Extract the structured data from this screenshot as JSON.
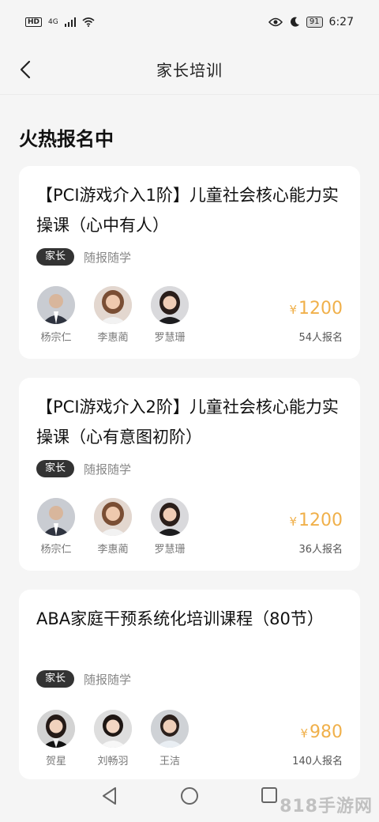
{
  "status_bar": {
    "hd": "HD",
    "network": "4G",
    "battery": "91",
    "time": "6:27"
  },
  "header": {
    "title": "家长培训",
    "back_icon": "chevron-left-icon"
  },
  "section": {
    "title": "火热报名中"
  },
  "courses": [
    {
      "title": "【PCI游戏介入1阶】儿童社会核心能力实操课（心中有人）",
      "tag": "家长",
      "mode": "随报随学",
      "teachers": [
        {
          "name": "杨宗仁"
        },
        {
          "name": "李惠蔺"
        },
        {
          "name": "罗慧珊"
        }
      ],
      "currency": "¥",
      "price": "1200",
      "enrolled": "54人报名"
    },
    {
      "title": "【PCI游戏介入2阶】儿童社会核心能力实操课（心有意图初阶）",
      "tag": "家长",
      "mode": "随报随学",
      "teachers": [
        {
          "name": "杨宗仁"
        },
        {
          "name": "李惠蔺"
        },
        {
          "name": "罗慧珊"
        }
      ],
      "currency": "¥",
      "price": "1200",
      "enrolled": "36人报名"
    },
    {
      "title": "ABA家庭干预系统化培训课程（80节）",
      "tag": "家长",
      "mode": "随报随学",
      "teachers": [
        {
          "name": "贺星"
        },
        {
          "name": "刘畅羽"
        },
        {
          "name": "王洁"
        }
      ],
      "currency": "¥",
      "price": "980",
      "enrolled": "140人报名"
    }
  ],
  "nav": {
    "back_icon": "triangle-back-icon",
    "home_icon": "circle-home-icon",
    "recent_icon": "square-recent-icon"
  },
  "watermark": "818手游网",
  "colors": {
    "price": "#f0b04a",
    "tag_bg": "#333333",
    "background": "#f5f5f5"
  }
}
